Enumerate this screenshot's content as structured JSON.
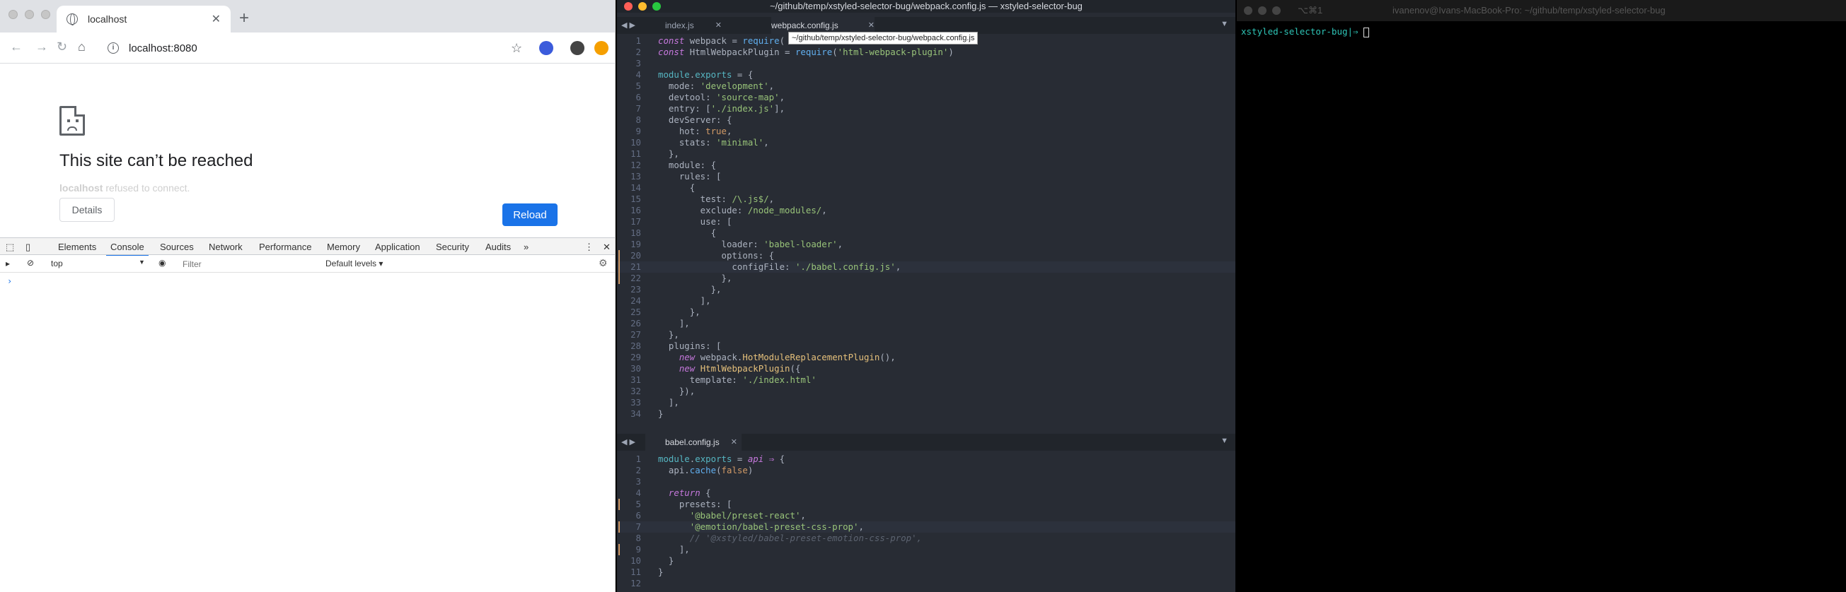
{
  "browser": {
    "tab_title": "localhost",
    "url": "localhost:8080",
    "error_title": "This site can’t be reached",
    "error_host": "localhost",
    "error_detail": " refused to connect.",
    "details_label": "Details",
    "reload_label": "Reload",
    "devtools": {
      "tabs": [
        "Elements",
        "Console",
        "Sources",
        "Network",
        "Performance",
        "Memory",
        "Application",
        "Security",
        "Audits"
      ],
      "active_tab": "Console",
      "more": "»",
      "context": "top",
      "filter_placeholder": "Filter",
      "levels": "Default levels ▾",
      "prompt": "›"
    }
  },
  "editor": {
    "window_title": "~/github/temp/xstyled-selector-bug/webpack.config.js — xstyled-selector-bug",
    "top_tabs": [
      "index.js",
      "webpack.config.js"
    ],
    "active_top_tab": "webpack.config.js",
    "tooltip": "~/github/temp/xstyled-selector-bug/webpack.config.js",
    "bottom_tab": "babel.config.js",
    "webpack_lines": [
      "<span class=\"kw\">const</span> webpack = <span class=\"fn\">require</span>(",
      "<span class=\"kw\">const</span> HtmlWebpackPlugin = <span class=\"fn\">require</span>(<span class=\"str\">'html-webpack-plugin'</span>)",
      "",
      "<span class=\"gl\">module</span>.<span class=\"gl\">exports</span> = {",
      "  mode: <span class=\"str\">'development'</span>,",
      "  devtool: <span class=\"str\">'source-map'</span>,",
      "  entry: [<span class=\"str\">'./index.js'</span>],",
      "  devServer: {",
      "    hot: <span class=\"bool\">true</span>,",
      "    stats: <span class=\"str\">'minimal'</span>,",
      "  },",
      "  module: {",
      "    rules: [",
      "      {",
      "        test: <span class=\"str\">/\\.js$/</span>,",
      "        exclude: <span class=\"str\">/node_modules/</span>,",
      "        use: [",
      "          {",
      "            loader: <span class=\"str\">'babel-loader'</span>,",
      "            options: {",
      "              configFile: <span class=\"str\">'./babel.config.js'</span>,",
      "            },",
      "          },",
      "        ],",
      "      },",
      "    ],",
      "  },",
      "  plugins: [",
      "    <span class=\"kw\">new</span> webpack.<span class=\"id\">HotModuleReplacementPlugin</span>(),",
      "    <span class=\"kw\">new</span> <span class=\"id\">HtmlWebpackPlugin</span>({",
      "      template: <span class=\"str\">'./index.html'</span>",
      "    }),",
      "  ],",
      "}"
    ],
    "babel_lines": [
      "<span class=\"gl\">module</span>.<span class=\"gl\">exports</span> = <span class=\"kw\">api</span> <span class=\"kw\">⇒</span> {",
      "  api.<span class=\"fn\">cache</span>(<span class=\"bool\">false</span>)",
      "",
      "  <span class=\"kw\">return</span> {",
      "    presets: [",
      "      <span class=\"str\">'@babel/preset-react'</span>,",
      "      <span class=\"str\">'@emotion/babel-preset-css-prop'</span>,",
      "      <span class=\"cmt\">// '@xstyled/babel-preset-emotion-css-prop',</span>",
      "    ],",
      "  }",
      "}",
      ""
    ]
  },
  "terminal": {
    "title": "ivanenov@Ivans-MacBook-Pro: ~/github/temp/xstyled-selector-bug",
    "shortcut": "⌥⌘1",
    "prompt": "xstyled-selector-bug|⇒ "
  }
}
